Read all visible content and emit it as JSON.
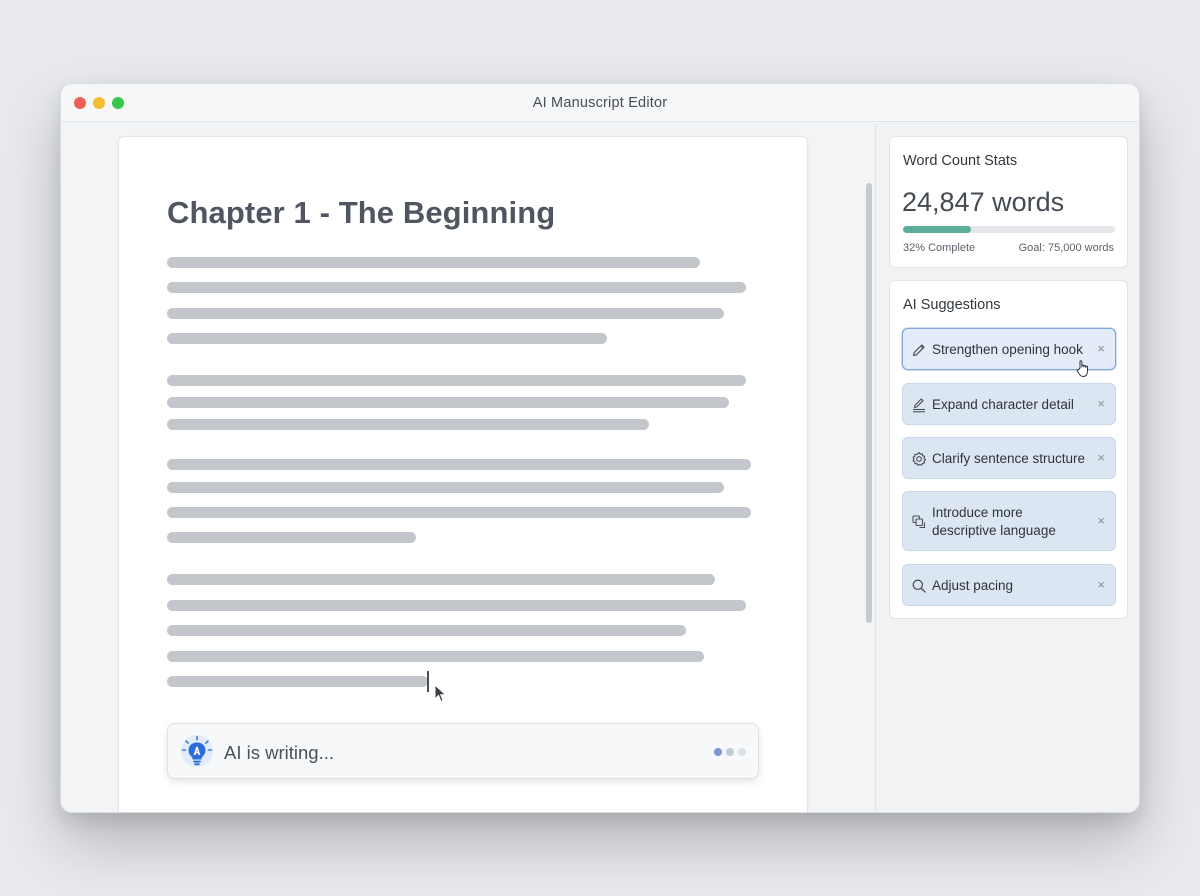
{
  "window": {
    "title": "AI Manuscript Editor"
  },
  "editor": {
    "chapter_title": "Chapter 1 - The Beginning",
    "ai_status": {
      "text": "AI is writing...",
      "icon": "lightbulb-ai-icon"
    }
  },
  "stats": {
    "heading": "Word Count Stats",
    "word_count": "24,847 words",
    "progress": 0.32,
    "progress_label": "32% Complete",
    "goal_label": "Goal: 75,000 words",
    "accent_color": "#5aae9a"
  },
  "suggestions": {
    "heading": "AI Suggestions",
    "items": [
      {
        "label": "Strengthen opening hook",
        "icon": "pencil-icon",
        "active": true
      },
      {
        "label": "Expand character detail",
        "icon": "edit-lines-icon",
        "active": false
      },
      {
        "label": "Clarify sentence structure",
        "icon": "gear-icon",
        "active": false
      },
      {
        "label": "Introduce more descriptive language",
        "icon": "layers-icon",
        "active": false
      },
      {
        "label": "Adjust pacing",
        "icon": "search-icon",
        "active": false
      }
    ],
    "close_glyph": "×"
  }
}
